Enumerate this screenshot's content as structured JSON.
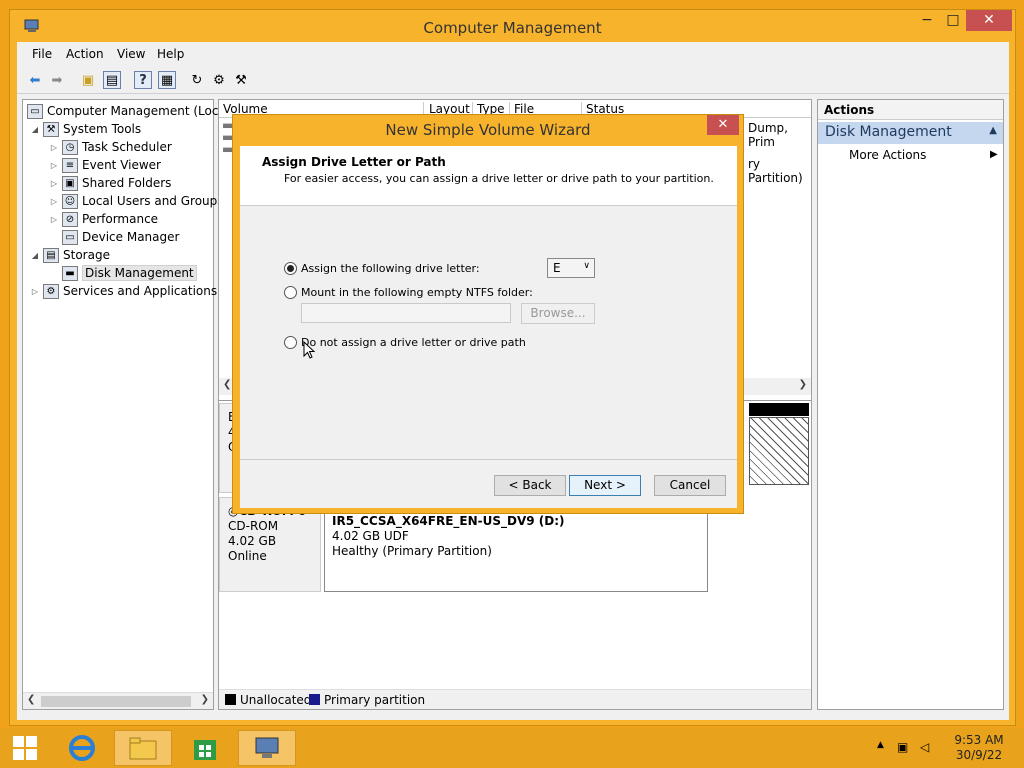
{
  "window": {
    "title": "Computer Management"
  },
  "menu": [
    "File",
    "Action",
    "View",
    "Help"
  ],
  "tree": {
    "root": "Computer Management (Local",
    "system_tools": "System Tools",
    "children": [
      "Task Scheduler",
      "Event Viewer",
      "Shared Folders",
      "Local Users and Groups",
      "Performance",
      "Device Manager"
    ],
    "storage": "Storage",
    "disk_management": "Disk Management",
    "services": "Services and Applications"
  },
  "volume_list": {
    "columns": [
      "Volume",
      "Layout",
      "Type",
      "File System",
      "Status"
    ],
    "row1_status": "Dump, Prim",
    "row2_status": "ry Partition)"
  },
  "disk_area": {
    "disk0_partial": [
      "B",
      "4(",
      "O"
    ],
    "cdrom": {
      "name": "CD-ROM 0",
      "type": "CD-ROM",
      "size": "4.02 GB",
      "status": "Online"
    },
    "cd_volume": {
      "name": "IR5_CCSA_X64FRE_EN-US_DV9  (D:)",
      "size": "4.02 GB UDF",
      "health": "Healthy (Primary Partition)"
    },
    "legend": {
      "unallocated": "Unallocated",
      "primary": "Primary partition"
    }
  },
  "actions": {
    "header": "Actions",
    "section": "Disk Management",
    "more": "More Actions"
  },
  "dialog": {
    "title": "New Simple Volume Wizard",
    "heading": "Assign Drive Letter or Path",
    "subheading": "For easier access, you can assign a drive letter or drive path to your partition.",
    "opt_letter": "Assign the following drive letter:",
    "drive_letter": "E",
    "opt_folder": "Mount in the following empty NTFS folder:",
    "browse": "Browse...",
    "opt_none": "Do not assign a drive letter or drive path",
    "back": "< Back",
    "next": "Next >",
    "cancel": "Cancel"
  },
  "taskbar": {
    "time": "9:53 AM",
    "date": "30/9/22"
  },
  "colors": {
    "accent": "#f7b32c",
    "primary_partition": "#1a1a8c",
    "unallocated": "#000000",
    "close": "#c75050"
  }
}
